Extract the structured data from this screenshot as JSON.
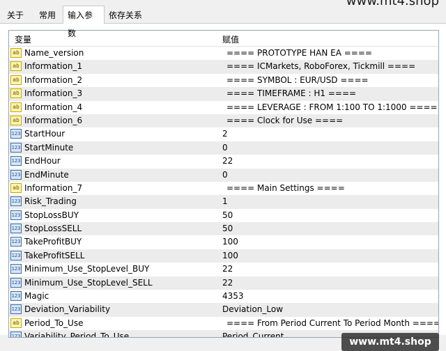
{
  "watermark_top": "www.mt4.shop",
  "watermark_bottom": "www.mt4.shop",
  "tabs": [
    {
      "label": "关于"
    },
    {
      "label": "常用"
    },
    {
      "label": "输入参数",
      "active": true
    },
    {
      "label": "依存关系"
    }
  ],
  "table": {
    "headers": [
      "变量",
      "赋值"
    ],
    "rows": [
      {
        "name": "Name_version",
        "value": "====  PROTOTYPE HAN EA  ====",
        "type": "ab"
      },
      {
        "name": "Information_1",
        "value": "====  ICMarkets, RoboForex, Tickmill  ====",
        "type": "ab"
      },
      {
        "name": "Information_2",
        "value": "====  SYMBOL : EUR/USD  ====",
        "type": "ab"
      },
      {
        "name": "Information_3",
        "value": "====  TIMEFRAME : H1  ====",
        "type": "ab"
      },
      {
        "name": "Information_4",
        "value": "====  LEVERAGE : FROM 1:100 TO 1:1000  ====",
        "type": "ab"
      },
      {
        "name": "Information_6",
        "value": "====  Clock for Use  ====",
        "type": "ab"
      },
      {
        "name": "StartHour",
        "value": "2",
        "type": "num"
      },
      {
        "name": "StartMinute",
        "value": "0",
        "type": "num"
      },
      {
        "name": "EndHour",
        "value": "22",
        "type": "num"
      },
      {
        "name": "EndMinute",
        "value": "0",
        "type": "num"
      },
      {
        "name": "Information_7",
        "value": "====  Main Settings  ====",
        "type": "ab"
      },
      {
        "name": "Risk_Trading",
        "value": "1",
        "type": "num"
      },
      {
        "name": "StopLossBUY",
        "value": "50",
        "type": "num"
      },
      {
        "name": "StopLossSELL",
        "value": "50",
        "type": "num"
      },
      {
        "name": "TakeProfitBUY",
        "value": "100",
        "type": "num"
      },
      {
        "name": "TakeProfitSELL",
        "value": "100",
        "type": "num"
      },
      {
        "name": "Minimum_Use_StopLevel_BUY",
        "value": "22",
        "type": "num"
      },
      {
        "name": "Minimum_Use_StopLevel_SELL",
        "value": "22",
        "type": "num"
      },
      {
        "name": "Magic",
        "value": "4353",
        "type": "num"
      },
      {
        "name": "Deviation_Variability",
        "value": "Deviation_Low",
        "type": "num"
      },
      {
        "name": "Period_To_Use",
        "value": "====  From Period Current To Period Month  ====",
        "type": "ab"
      },
      {
        "name": "Variability_Period_To_Use",
        "value": "Period_Current",
        "type": "num"
      }
    ]
  },
  "icons": {
    "ab": "ab",
    "num": "123"
  }
}
